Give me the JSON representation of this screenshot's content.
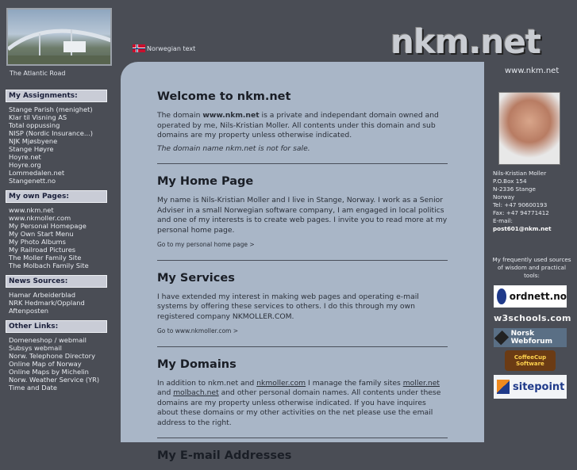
{
  "header": {
    "photo_caption": "The Atlantic Road",
    "language_link": "Norwegian text",
    "logo": "nkm.net",
    "site_url": "www.nkm.net"
  },
  "sidebar": {
    "assignments": {
      "title": "My Assignments:",
      "items": [
        "Stange Parish (menighet)",
        "Klar til Visning AS",
        "Total oppussing",
        "NISP (Nordic Insurance...)",
        "NJK Mjøsbyene",
        "Stange Høyre",
        "Hoyre.net",
        "Hoyre.org",
        "Lommedalen.net",
        "Stangenett.no"
      ]
    },
    "own_pages": {
      "title": "My own Pages:",
      "items": [
        "www.nkm.net",
        "www.nkmoller.com",
        "My Personal Homepage",
        "My Own Start Menu",
        "My Photo Albums",
        "My Railroad Pictures",
        "The Moller Family Site",
        "The Molbach Family Site"
      ]
    },
    "news": {
      "title": "News Sources:",
      "items": [
        "Hamar Arbeiderblad",
        "NRK Hedmark/Oppland",
        "Aftenposten"
      ]
    },
    "other": {
      "title": "Other Links:",
      "items": [
        "Domeneshop / webmail",
        "Subsys webmail",
        "Norw. Telephone Directory",
        "Online Map of Norway",
        "Online Maps by Michelin",
        "Norw. Weather Service (YR)",
        "Time and Date"
      ]
    }
  },
  "main": {
    "welcome": {
      "title": "Welcome to nkm.net",
      "p1_a": "The domain ",
      "p1_bold": "www.nkm.net",
      "p1_b": " is a private and independant domain owned and operated by me, Nils-Kristian Moller. All contents under this domain and sub domains are my property unless otherwise indicated.",
      "note": "The domain name nkm.net is not for sale."
    },
    "home": {
      "title": "My Home Page",
      "text": "My name is Nils-Kristian Moller and I live in Stange, Norway. I work as a Senior Adviser in a small Norwegian software company, I am engaged in local politics and one of my interests is to create web pages. I invite you to read more at my personal home page.",
      "link": "Go to my personal home page >"
    },
    "services": {
      "title": "My Services",
      "text": "I have extended my interest in making web pages and operating e-mail systems by offering these services to others. I do this through my own registered company NKMOLLER.COM.",
      "link": "Go to www.nkmoller.com >"
    },
    "domains": {
      "title": "My Domains",
      "t1": "In addition to nkm.net and ",
      "l1": "nkmoller.com",
      "t2": " I manage the family sites ",
      "l2": "moller.net",
      "t3": " and ",
      "l3": "molbach.net",
      "t4": " and other personal domain names. All contents under these domains are my property unless otherwise indicated. If you have inquires about these domains or my other activities on the net please use the email address to the right."
    },
    "email": {
      "title": "My E-mail Addresses"
    }
  },
  "contact": {
    "name": "Nils-Kristian Moller",
    "box": "P.O.Box 154",
    "city": "N-2336 Stange",
    "country": "Norway",
    "tel": "Tel: +47 90600193",
    "fax": "Fax: +47 94771412",
    "email_label": "E-mail:",
    "email": "post601@nkm.net"
  },
  "resources": {
    "caption": "My frequently used sources of wisdom and practical tools:",
    "badges": [
      "ordnett.no",
      "w3schools.com",
      "Norsk Webforum",
      "CoffeeCup Software",
      "sitepoint"
    ]
  }
}
